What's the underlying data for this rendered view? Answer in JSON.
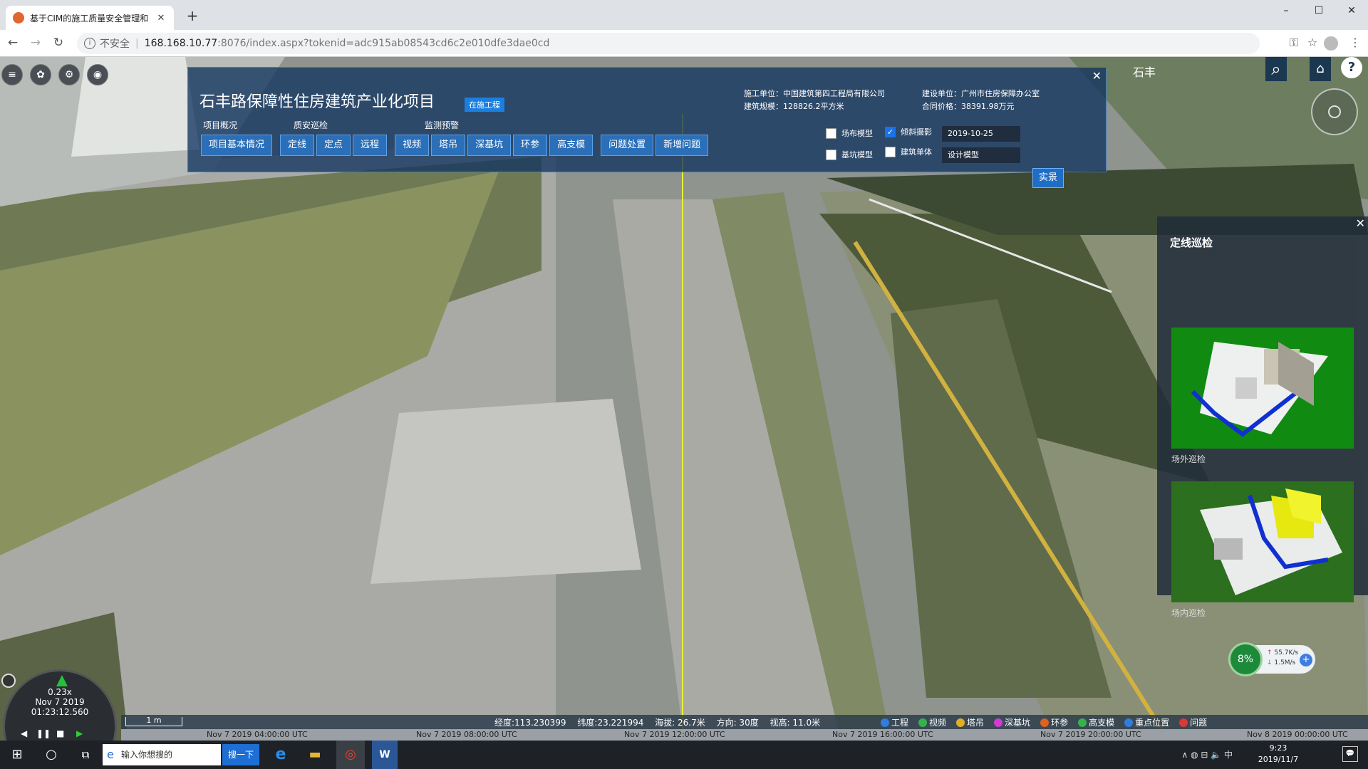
{
  "browser": {
    "tab_title": "基于CIM的施工质量安全管理和",
    "tab_close": "✕",
    "new_tab": "+",
    "win": {
      "min": "–",
      "max": "☐",
      "close": "✕"
    },
    "nav": {
      "back": "←",
      "forward": "→",
      "reload": "↻"
    },
    "insecure": "不安全",
    "url_host": "168.168.10.77",
    "url_path": ":8076/index.aspx?tokenid=adc915ab08543cd6c2e010dfe3dae0cd",
    "icons": {
      "key": "⚿",
      "star": "☆",
      "menu": "⋮"
    }
  },
  "toolbar_icons": [
    "≡",
    "✿",
    "⚙",
    "◉"
  ],
  "project": {
    "title": "石丰路保障性住房建筑产业化项目",
    "status_badge": "在施工程",
    "groups": [
      "项目概况",
      "质安巡检",
      "监测预警"
    ],
    "buttons": {
      "overview": [
        "项目基本情况"
      ],
      "inspect": [
        "定线",
        "定点",
        "远程"
      ],
      "monitor": [
        "视频",
        "塔吊",
        "深基坑",
        "环参",
        "高支模"
      ],
      "issues": [
        "问题处置",
        "新增问题"
      ]
    },
    "meta": {
      "constructor": "施工单位：中国建筑第四工程局有限公司",
      "owner": "建设单位：广州市住房保障办公室",
      "scale": "建筑规模：128826.2平方米",
      "price": "合同价格：38391.98万元"
    },
    "layers": {
      "site_model": "场布模型",
      "oblique": "倾斜摄影",
      "pit_model": "基坑模型",
      "building": "建筑单体",
      "date": "2019-10-25",
      "model_select": "设计模型",
      "realview": "实景",
      "site_checked": false,
      "oblique_checked": true,
      "pit_checked": false,
      "building_checked": false
    },
    "close": "✕"
  },
  "search": {
    "label": "石丰",
    "search_icon": "⌕",
    "home_icon": "⌂",
    "help_icon": "?"
  },
  "side_panel": {
    "title": "定线巡检",
    "close": "✕",
    "items": [
      {
        "label": "场外巡检"
      },
      {
        "label": "场内巡检"
      }
    ]
  },
  "network": {
    "percent": "8%",
    "up": "55.7K/s",
    "down": "1.5M/s",
    "plus": "+"
  },
  "clock": {
    "speed": "0.23x",
    "date": "Nov 7 2019",
    "time": "01:23:12.560",
    "controls": [
      "◀",
      "❚❚",
      "■",
      "▶"
    ]
  },
  "status": {
    "scale": "1 m",
    "lon": "经度:113.230399",
    "lat": "纬度:23.221994",
    "alt": "海拔: 26.7米",
    "heading": "方向: 30度",
    "view_h": "视高: 11.0米"
  },
  "legend": [
    {
      "label": "工程",
      "color": "#2f7de0"
    },
    {
      "label": "视频",
      "color": "#35b34a"
    },
    {
      "label": "塔吊",
      "color": "#e0b020"
    },
    {
      "label": "深基坑",
      "color": "#d33ad3"
    },
    {
      "label": "环参",
      "color": "#e26020"
    },
    {
      "label": "高支模",
      "color": "#35b34a"
    },
    {
      "label": "重点位置",
      "color": "#2f7de0"
    },
    {
      "label": "问题",
      "color": "#d83a3a"
    }
  ],
  "timeline": [
    "Nov 7 2019 04:00:00 UTC",
    "Nov 7 2019 08:00:00 UTC",
    "Nov 7 2019 12:00:00 UTC",
    "Nov 7 2019 16:00:00 UTC",
    "Nov 7 2019 20:00:00 UTC",
    "Nov 8 2019 00:00:00 UTC"
  ],
  "taskbar": {
    "start": "⊞",
    "cortana": "○",
    "taskview": "⧉",
    "search_placeholder": "输入你想搜的",
    "search_btn": "搜一下",
    "apps": [
      "e",
      "▬",
      "◎",
      "W"
    ],
    "tray_icons": "∧ ◍ ⊟ 🔈 中",
    "time": "9:23",
    "date": "2019/11/7",
    "notif": "💬"
  }
}
